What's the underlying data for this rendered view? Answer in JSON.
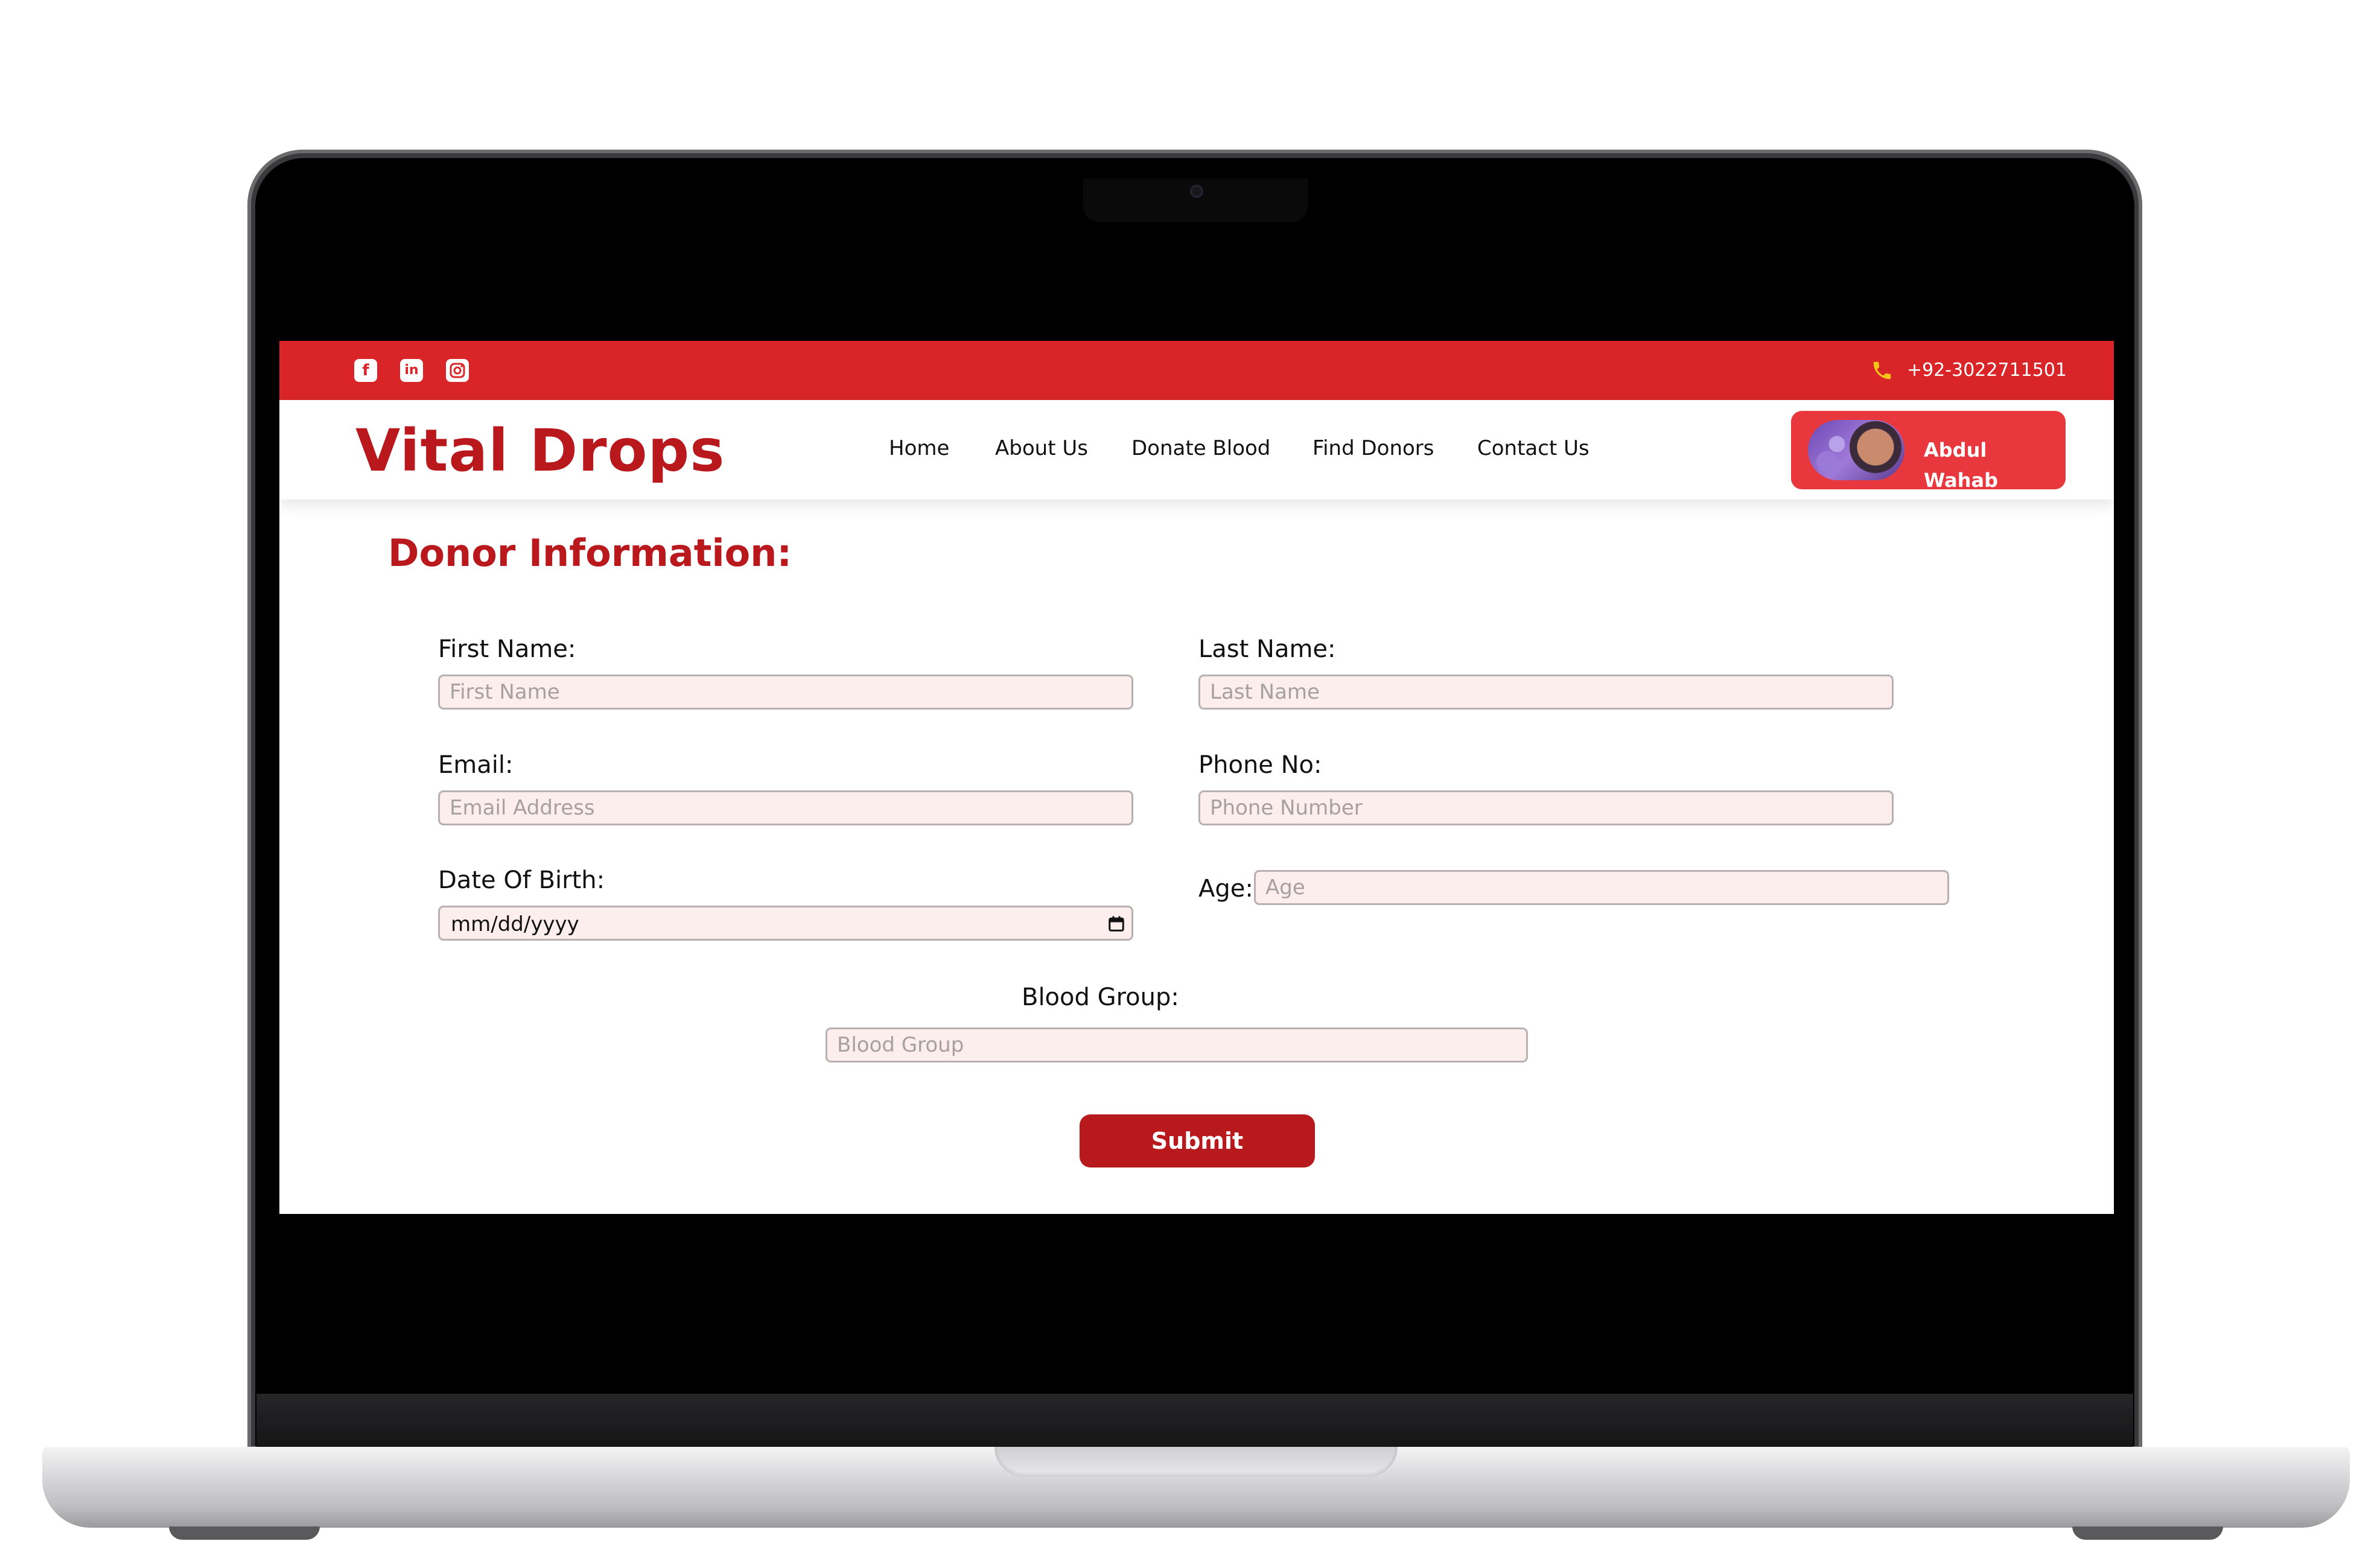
{
  "topbar": {
    "social_icons": [
      "facebook-icon",
      "linkedin-icon",
      "instagram-icon"
    ],
    "phone": "+92-3022711501",
    "background": "#d92528"
  },
  "navbar": {
    "logo": "Vital Drops",
    "links": [
      "Home",
      "About Us",
      "Donate Blood",
      "Find Donors",
      "Contact Us"
    ],
    "user_name": "Abdul Wahab"
  },
  "form": {
    "title": "Donor Information:",
    "first_name": {
      "label": "First Name:",
      "placeholder": "First Name"
    },
    "last_name": {
      "label": "Last Name:",
      "placeholder": "Last Name"
    },
    "email": {
      "label": "Email:",
      "placeholder": "Email Address"
    },
    "phone": {
      "label": "Phone No:",
      "placeholder": "Phone Number"
    },
    "dob": {
      "label": "Date Of Birth:",
      "value": "mm/dd/yyyy"
    },
    "age": {
      "label": "Age:",
      "placeholder": "Age"
    },
    "blood_group": {
      "label": "Blood Group:",
      "placeholder": "Blood Group"
    },
    "submit": "Submit"
  },
  "colors": {
    "brand": "#b9181d",
    "accent": "#d92528",
    "user_button": "#e8383d",
    "field_bg": "#fdeeee"
  }
}
